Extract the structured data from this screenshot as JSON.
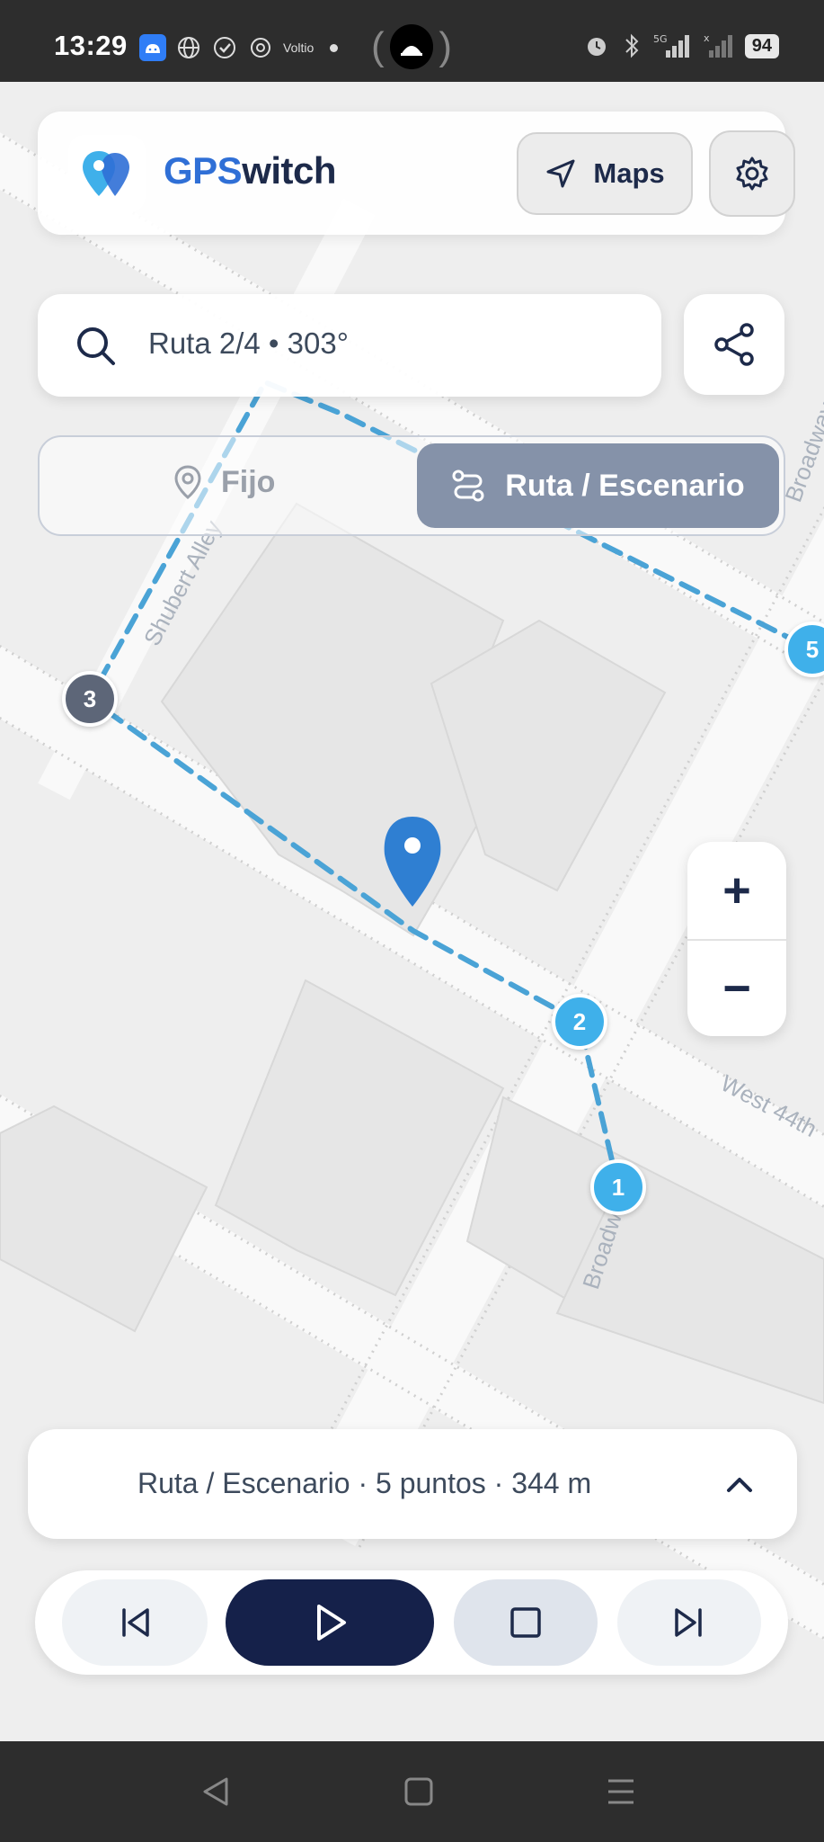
{
  "status_bar": {
    "time": "13:29",
    "app_label": "Voltio",
    "battery": "94",
    "network": "5G"
  },
  "header": {
    "app_name_part1": "GPS",
    "app_name_part2": "witch",
    "maps_label": "Maps"
  },
  "search": {
    "text": "Ruta 2/4 • 303°"
  },
  "mode_toggle": {
    "fixed_label": "Fijo",
    "route_label": "Ruta / Escenario",
    "selected": "route"
  },
  "map": {
    "street_labels": [
      "Shubert Alley",
      "Broadway",
      "West 44th",
      "Broadway"
    ],
    "waypoints": [
      "1",
      "2",
      "3",
      "5"
    ],
    "route_color": "#4aa3d6"
  },
  "zoom": {
    "in_label": "+",
    "out_label": "−"
  },
  "route_info": {
    "text": "Ruta / Escenario · 5 puntos · 344 m"
  },
  "colors": {
    "accent": "#2f6fd6",
    "brand_dark": "#1d2a4a",
    "play_bg": "#15214a",
    "waypoint_blue": "#3fb0ea",
    "waypoint_gray": "#5d6678"
  }
}
